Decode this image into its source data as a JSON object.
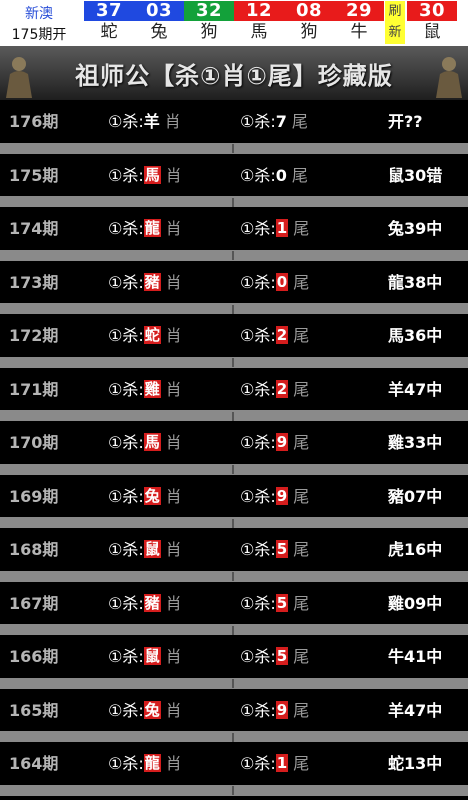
{
  "header": {
    "region": "新澳",
    "period": "175期开",
    "balls": [
      {
        "num": "37",
        "zodiac": "蛇",
        "color": "#1f49e0"
      },
      {
        "num": "03",
        "zodiac": "兔",
        "color": "#1f49e0"
      },
      {
        "num": "32",
        "zodiac": "狗",
        "color": "#13a13a"
      },
      {
        "num": "12",
        "zodiac": "馬",
        "color": "#e81b1b"
      },
      {
        "num": "08",
        "zodiac": "狗",
        "color": "#e81b1b"
      },
      {
        "num": "29",
        "zodiac": "牛",
        "color": "#e81b1b"
      },
      {
        "num": "30",
        "zodiac": "鼠",
        "color": "#e81b1b"
      }
    ],
    "refresh_label": "刷新"
  },
  "banner": {
    "title": "祖师公【杀①肖①尾】珍藏版"
  },
  "kill_prefix": "①杀:",
  "xiao_suffix": "肖",
  "wei_suffix": "尾",
  "rows": [
    {
      "issue": "176期",
      "xiao": "羊",
      "wei": "7",
      "result": "开??",
      "highlight": false
    },
    {
      "issue": "175期",
      "xiao": "馬",
      "wei": "0",
      "result": "鼠30错",
      "highlight": false,
      "xiao_red": true
    },
    {
      "issue": "174期",
      "xiao": "龍",
      "wei": "1",
      "result": "兔39中",
      "highlight": true
    },
    {
      "issue": "173期",
      "xiao": "豬",
      "wei": "0",
      "result": "龍38中",
      "highlight": true
    },
    {
      "issue": "172期",
      "xiao": "蛇",
      "wei": "2",
      "result": "馬36中",
      "highlight": true
    },
    {
      "issue": "171期",
      "xiao": "雞",
      "wei": "2",
      "result": "羊47中",
      "highlight": true
    },
    {
      "issue": "170期",
      "xiao": "馬",
      "wei": "9",
      "result": "雞33中",
      "highlight": true
    },
    {
      "issue": "169期",
      "xiao": "兔",
      "wei": "9",
      "result": "豬07中",
      "highlight": true
    },
    {
      "issue": "168期",
      "xiao": "鼠",
      "wei": "5",
      "result": "虎16中",
      "highlight": true
    },
    {
      "issue": "167期",
      "xiao": "豬",
      "wei": "5",
      "result": "雞09中",
      "highlight": true
    },
    {
      "issue": "166期",
      "xiao": "鼠",
      "wei": "5",
      "result": "牛41中",
      "highlight": true
    },
    {
      "issue": "165期",
      "xiao": "兔",
      "wei": "9",
      "result": "羊47中",
      "highlight": true
    },
    {
      "issue": "164期",
      "xiao": "龍",
      "wei": "1",
      "result": "蛇13中",
      "highlight": true
    }
  ]
}
